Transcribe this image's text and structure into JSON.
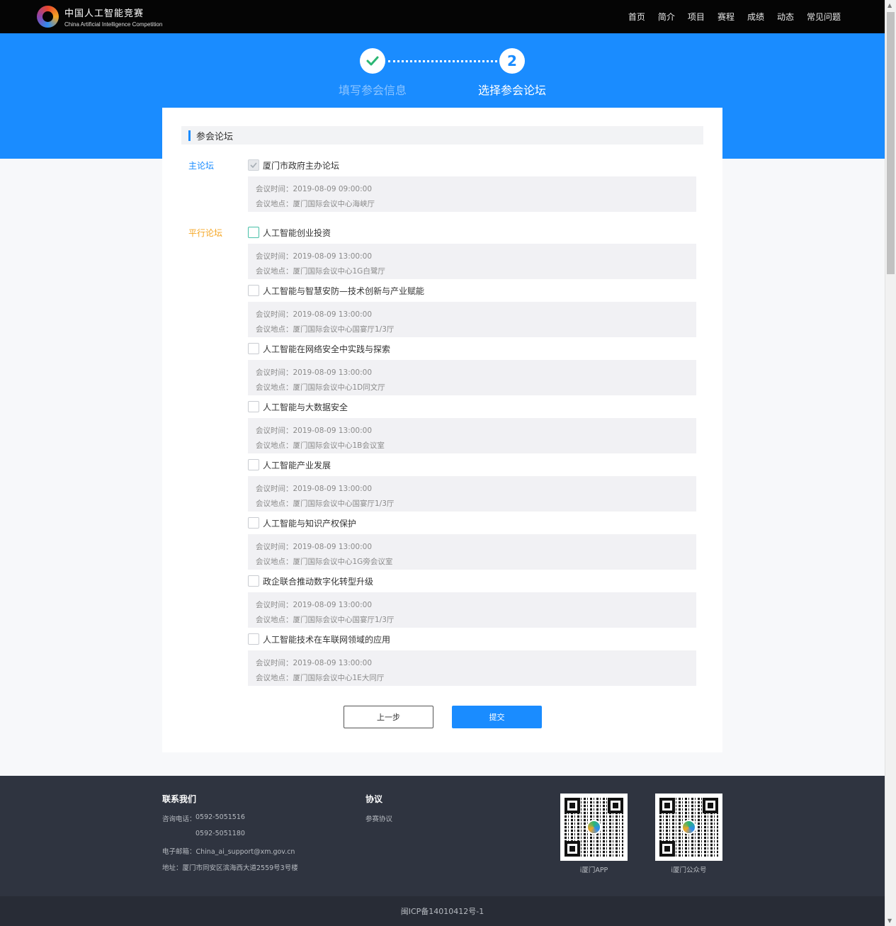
{
  "header": {
    "logo_cn": "中国人工智能竞赛",
    "logo_en": "China Artificial Intelligence Competition",
    "nav": [
      "首页",
      "简介",
      "项目",
      "赛程",
      "成绩",
      "动态",
      "常见问题"
    ]
  },
  "steps": {
    "step1_label": "填写参会信息",
    "step2_number": "2",
    "step2_label": "选择参会论坛"
  },
  "form": {
    "section_title": "参会论坛",
    "main_label": "主论坛",
    "parallel_label": "平行论坛",
    "main_forum": {
      "name": "厦门市政府主办论坛",
      "checked": true,
      "time": "会议时间：2019-08-09 09:00:00",
      "place": "会议地点：厦门国际会议中心海峡厅"
    },
    "parallel_forums": [
      {
        "name": "人工智能创业投资",
        "time": "会议时间：2019-08-09 13:00:00",
        "place": "会议地点：厦门国际会议中心1G白鹭厅"
      },
      {
        "name": "人工智能与智慧安防—技术创新与产业赋能",
        "time": "会议时间：2019-08-09 13:00:00",
        "place": "会议地点：厦门国际会议中心国宴厅1/3厅"
      },
      {
        "name": "人工智能在网络安全中实践与探索",
        "time": "会议时间：2019-08-09 13:00:00",
        "place": "会议地点：厦门国际会议中心1D同文厅"
      },
      {
        "name": "人工智能与大数据安全",
        "time": "会议时间：2019-08-09 13:00:00",
        "place": "会议地点：厦门国际会议中心1B会议室"
      },
      {
        "name": "人工智能产业发展",
        "time": "会议时间：2019-08-09 13:00:00",
        "place": "会议地点：厦门国际会议中心国宴厅1/3厅"
      },
      {
        "name": "人工智能与知识产权保护",
        "time": "会议时间：2019-08-09 13:00:00",
        "place": "会议地点：厦门国际会议中心1G旁会议室"
      },
      {
        "name": "政企联合推动数字化转型升级",
        "time": "会议时间：2019-08-09 13:00:00",
        "place": "会议地点：厦门国际会议中心国宴厅1/3厅"
      },
      {
        "name": "人工智能技术在车联网领域的应用",
        "time": "会议时间：2019-08-09 13:00:00",
        "place": "会议地点：厦门国际会议中心1E大同厅"
      }
    ],
    "prev_label": "上一步",
    "submit_label": "提交"
  },
  "footer": {
    "contact_title": "联系我们",
    "phone_label": "咨询电话：",
    "phone1": "0592-5051516",
    "phone2": "0592-5051180",
    "email": "电子邮箱：China_ai_support@xm.gov.cn",
    "address": "地址：厦门市同安区滨海西大道2559号3号楼",
    "agreement_title": "协议",
    "agreement_link": "参赛协议",
    "qr1_caption": "i厦门APP",
    "qr2_caption": "i厦门公众号",
    "icp": "闽ICP备14010412号-1"
  },
  "colors": {
    "brand_blue": "#1a8cff",
    "accent_orange": "#f5a623",
    "header_bg": "#050505",
    "footer_bg": "#2f3440"
  }
}
